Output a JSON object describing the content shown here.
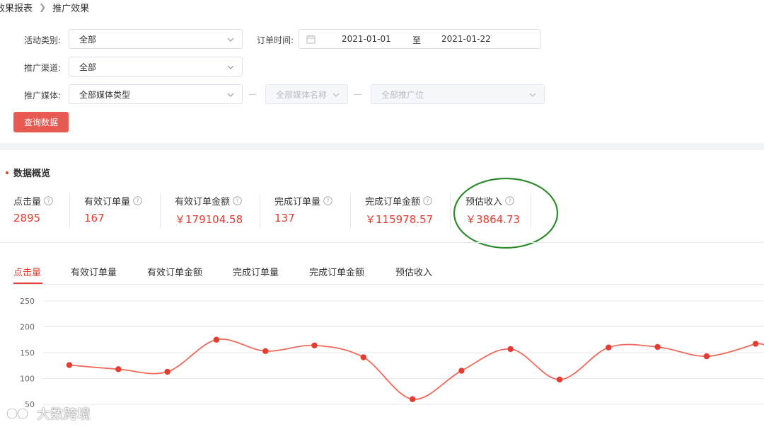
{
  "breadcrumb": {
    "parent": "效果报表",
    "current": "推广效果"
  },
  "filters": {
    "activity_type": {
      "label": "活动类别:",
      "value": "全部"
    },
    "order_time": {
      "label": "订单时间:",
      "start": "2021-01-01",
      "separator": "至",
      "end": "2021-01-22"
    },
    "channel": {
      "label": "推广渠道:",
      "value": "全部"
    },
    "media": {
      "label": "推广媒体:",
      "type_value": "全部媒体类型",
      "name_placeholder": "全部媒体名称",
      "position_placeholder": "全部推广位",
      "dash": "—"
    },
    "query_button": "查询数据"
  },
  "overview": {
    "title": "数据概览",
    "metrics": [
      {
        "label": "点击量",
        "value": "2895"
      },
      {
        "label": "有效订单量",
        "value": "167"
      },
      {
        "label": "有效订单金额",
        "value": "￥179104.58"
      },
      {
        "label": "完成订单量",
        "value": "137"
      },
      {
        "label": "完成订单金额",
        "value": "￥115978.57"
      },
      {
        "label": "预估收入",
        "value": "￥3864.73"
      }
    ]
  },
  "tabs": [
    "点击量",
    "有效订单量",
    "有效订单金额",
    "完成订单量",
    "完成订单金额",
    "预估收入"
  ],
  "active_tab": 0,
  "colors": {
    "accent": "#e63b30",
    "button": "#e65a52",
    "highlight_circle": "#2e8b2e"
  },
  "chart_data": {
    "type": "line",
    "y_ticks": [
      "250",
      "200",
      "150",
      "100",
      "50"
    ],
    "ylim": [
      50,
      250
    ],
    "grid": true,
    "series": [
      {
        "values": [
          126,
          118,
          113,
          175,
          153,
          164,
          141,
          60,
          115,
          157,
          98,
          160,
          161,
          143,
          167
        ]
      }
    ]
  },
  "watermark": "大数跨境"
}
